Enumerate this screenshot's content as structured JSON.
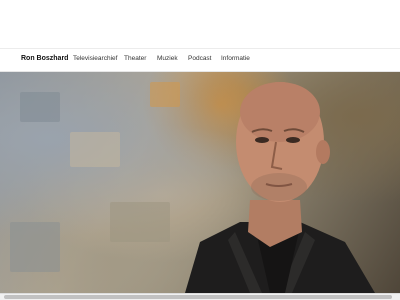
{
  "nav": {
    "brand": "Ron Boszhard",
    "items": [
      "Televisiearchief",
      "Theater",
      "Muziek",
      "Podcast",
      "Informatie"
    ]
  },
  "hero": {
    "description_hidden": false
  },
  "colors": {
    "nav_text": "#333333",
    "brand_text": "#111111",
    "background": "#ffffff"
  }
}
